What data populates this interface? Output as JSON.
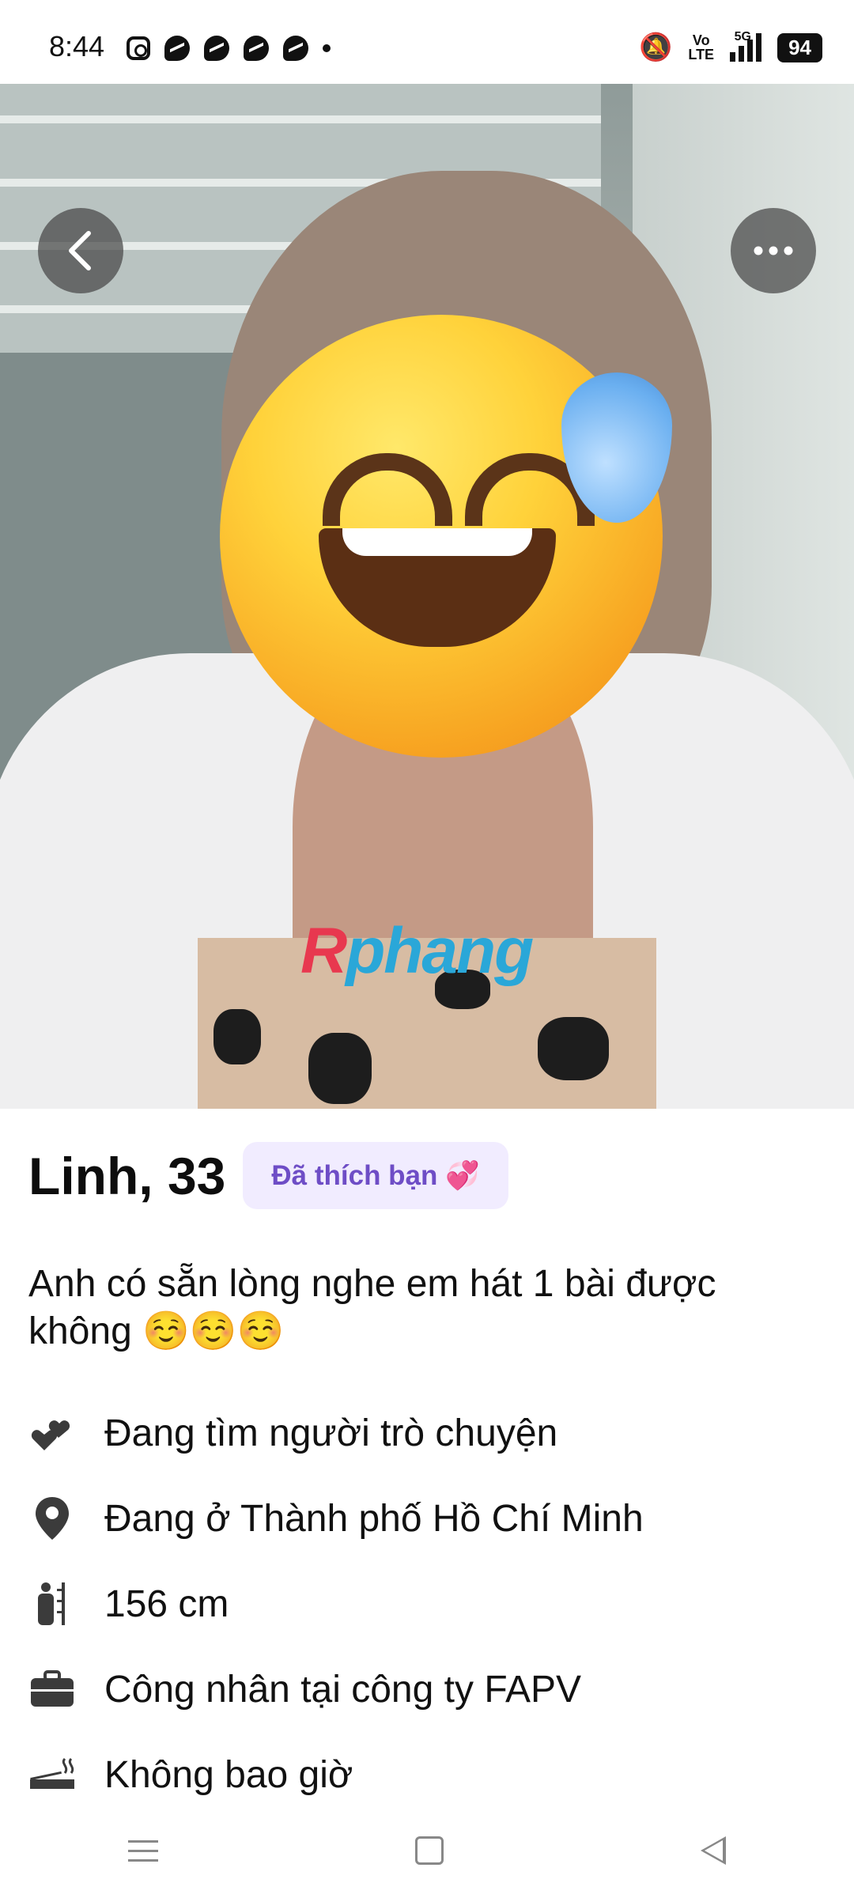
{
  "status_bar": {
    "time": "8:44",
    "notification_icons": [
      "instagram-icon",
      "messenger-icon",
      "messenger-icon",
      "messenger-icon",
      "messenger-icon",
      "dot-icon"
    ],
    "volte": "Vo\nLTE",
    "network": "5G",
    "battery": "94"
  },
  "photo": {
    "watermark_a": "R",
    "watermark_b": "phang",
    "back_icon": "chevron-left-icon",
    "more_icon": "more-options-icon"
  },
  "profile": {
    "name_age": "Linh, 33",
    "liked_badge": "Đã thích bạn 💞",
    "bio": "Anh có sẵn lòng nghe em hát 1 bài được không ☺️☺️☺️",
    "details": [
      {
        "icon": "hearts-icon",
        "text": "Đang tìm người trò chuyện"
      },
      {
        "icon": "location-pin-icon",
        "text": "Đang ở Thành phố Hồ Chí Minh"
      },
      {
        "icon": "height-icon",
        "text": "156 cm"
      },
      {
        "icon": "briefcase-icon",
        "text": "Công nhân tại công ty FAPV"
      },
      {
        "icon": "smoking-icon",
        "text": "Không bao giờ"
      }
    ]
  },
  "colors": {
    "badge_bg": "#f1ecff",
    "badge_text": "#6e4dc6"
  }
}
